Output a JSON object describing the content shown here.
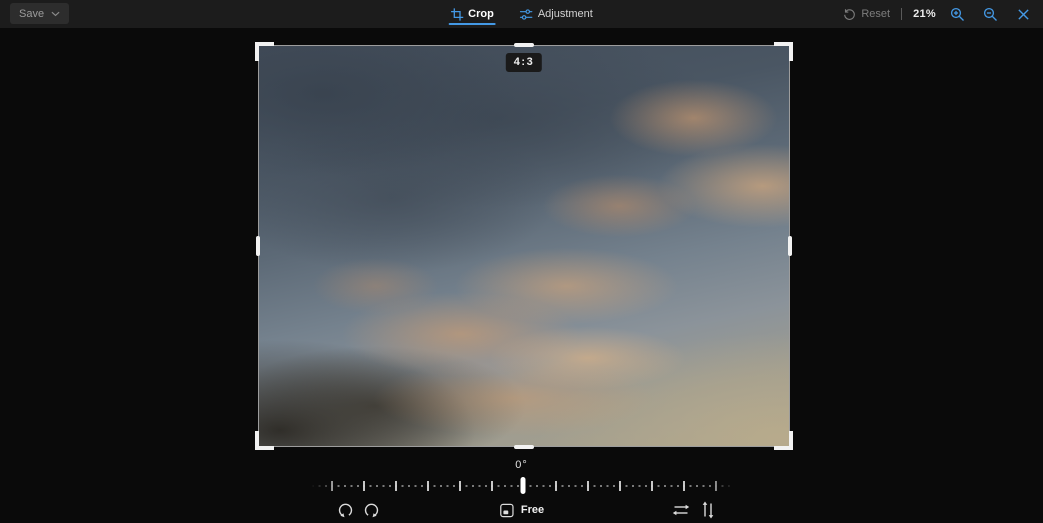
{
  "colors": {
    "accent": "#4499e5",
    "topbar_bg": "#1c1c1c",
    "canvas_bg": "#0a0a0a",
    "handle": "#f2f2f2"
  },
  "topbar": {
    "save": {
      "label": "Save"
    },
    "tabs": [
      {
        "label": "Crop",
        "active": true
      },
      {
        "label": "Adjustment",
        "active": false
      }
    ],
    "reset_label": "Reset",
    "zoom_level": "21%"
  },
  "crop": {
    "aspect_ratio_badge": "4:3",
    "rotation_degrees": "0°",
    "aspect_mode_label": "Free"
  },
  "icons": {
    "save_chevron": "chevron-down",
    "crop_tab": "crop-frame",
    "adjustment_tab": "adjustment-sliders",
    "reset": "history-arrow",
    "zoom_in": "magnifier-plus",
    "zoom_out": "magnifier-minus",
    "close": "x-cross",
    "rotate_left": "rotate-counterclockwise",
    "rotate_right": "rotate-clockwise",
    "aspect_mode": "aspect-ratio-box",
    "flip_horizontal": "arrows-left-right",
    "flip_vertical": "arrows-up-down"
  }
}
